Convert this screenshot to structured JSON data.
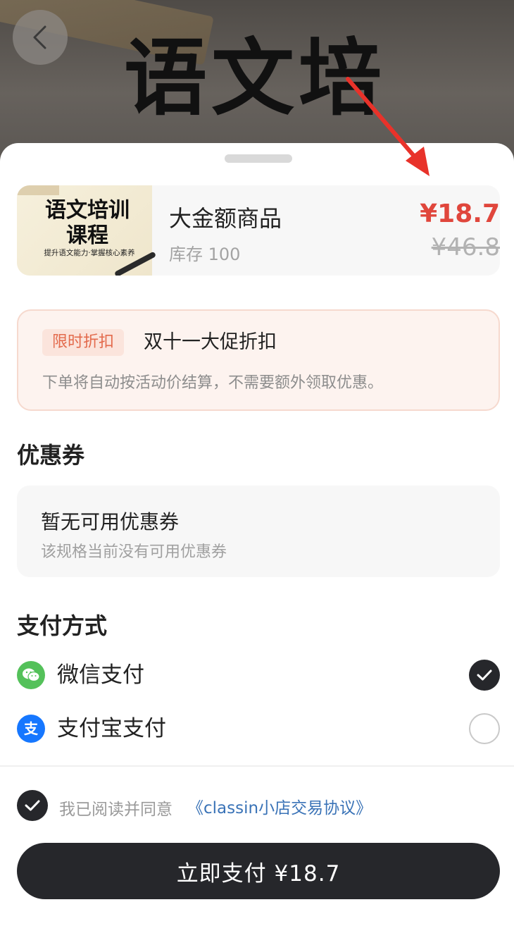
{
  "hero": {
    "title": "语文培"
  },
  "product": {
    "thumb_title": "语文培训课程",
    "thumb_subtitle": "提升语文能力·掌握核心素养",
    "name": "大金额商品",
    "stock": "库存 100",
    "price": "¥18.7",
    "original_price": "¥46.8"
  },
  "promotion": {
    "tag": "限时折扣",
    "title": "双十一大促折扣",
    "description": "下单将自动按活动价结算，不需要额外领取优惠。"
  },
  "coupons": {
    "section_title": "优惠券",
    "empty_title": "暂无可用优惠券",
    "empty_subtitle": "该规格当前没有可用优惠券"
  },
  "payment": {
    "section_title": "支付方式",
    "methods": [
      {
        "label": "微信支付",
        "icon": "wechat-pay-icon",
        "selected": true
      },
      {
        "label": "支付宝支付",
        "icon": "alipay-icon",
        "selected": false
      }
    ]
  },
  "agreement": {
    "text": "我已阅读并同意",
    "link": "《classin小店交易协议》",
    "checked": true
  },
  "pay_button": {
    "label": "立即支付 ¥18.7"
  },
  "colors": {
    "accent_red": "#e0463c",
    "primary_dark": "#26272b",
    "link_blue": "#3a73b7",
    "wechat_green": "#54c15a",
    "alipay_blue": "#1677ff"
  }
}
